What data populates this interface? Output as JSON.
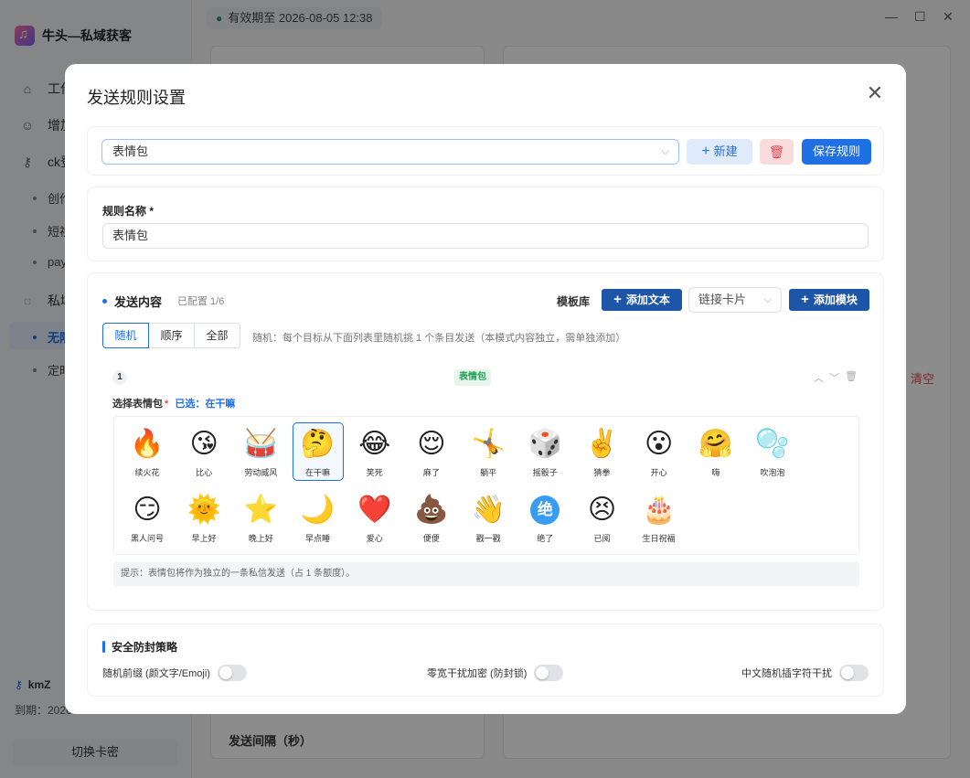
{
  "app": {
    "brand": "牛头—私域获客",
    "expiry_badge": "有效期至 2026-08-05 12:38",
    "window_controls": [
      "minimize-icon",
      "maximize-icon",
      "close-icon"
    ],
    "nav": [
      {
        "label": "工作",
        "icon": "home-icon"
      },
      {
        "label": "增加",
        "icon": "user-icon"
      },
      {
        "label": "ck登",
        "icon": "key-icon"
      }
    ],
    "nav_sub": [
      "创作",
      "短视",
      "pay"
    ],
    "nav2": {
      "label": "私域",
      "icon": "chat-icon"
    },
    "nav2_sub": [
      {
        "label": "无限",
        "active": true
      },
      {
        "label": "定时",
        "active": false
      }
    ],
    "user": {
      "name": "kmZ",
      "expiry": "到期：2026-08-05 12:38"
    },
    "switch_label": "切换卡密",
    "clear_label": "清空",
    "interval_label": "发送间隔（秒）"
  },
  "modal": {
    "title": "发送规则设置",
    "rule_select": "表情包",
    "new_label": "新建",
    "save_label": "保存规则",
    "name_label": "规则名称 *",
    "name_value": "表情包",
    "content": {
      "title": "发送内容",
      "count": "已配置 1/6",
      "template_label": "模板库",
      "add_text_label": "添加文本",
      "link_select": "链接卡片",
      "add_module_label": "添加模块",
      "modes": [
        {
          "label": "随机",
          "active": true
        },
        {
          "label": "顺序",
          "active": false
        },
        {
          "label": "全部",
          "active": false
        }
      ],
      "mode_hint": "随机：每个目标从下面列表里随机挑 1 个条目发送（本模式内容独立，需单独添加）",
      "item": {
        "index": "1",
        "tag": "表情包",
        "pick_label": "选择表情包",
        "pick_required": "*",
        "selected_label": "已选：在干嘛",
        "emojis": [
          {
            "glyph": "🔥",
            "name": "续火花"
          },
          {
            "glyph": "😘",
            "name": "比心"
          },
          {
            "glyph": "🥁",
            "name": "劳动威风"
          },
          {
            "glyph": "🤔",
            "name": "在干嘛",
            "selected": true
          },
          {
            "glyph": "😂",
            "name": "笑死"
          },
          {
            "glyph": "😌",
            "name": "麻了"
          },
          {
            "glyph": "🤸",
            "name": "躺平"
          },
          {
            "glyph": "🎲",
            "name": "摇骰子"
          },
          {
            "glyph": "✌️",
            "name": "猜拳"
          },
          {
            "glyph": "😮",
            "name": "开心"
          },
          {
            "glyph": "🤗",
            "name": "嗨"
          },
          {
            "glyph": "🫧",
            "name": "吹泡泡"
          },
          {
            "glyph": "😏",
            "name": "黑人问号"
          },
          {
            "glyph": "🌞",
            "name": "早上好"
          },
          {
            "glyph": "⭐",
            "name": "晚上好"
          },
          {
            "glyph": "🌙",
            "name": "早点睡"
          },
          {
            "glyph": "❤️",
            "name": "爱心"
          },
          {
            "glyph": "💩",
            "name": "便便"
          },
          {
            "glyph": "👋",
            "name": "戳一戳"
          },
          {
            "glyph": "绝",
            "name": "绝了"
          },
          {
            "glyph": "😣",
            "name": "已阅"
          },
          {
            "glyph": "🎂",
            "name": "生日祝福"
          }
        ],
        "tip": "提示：表情包将作为独立的一条私信发送（占 1 条额度）。"
      }
    },
    "security": {
      "title": "安全防封策略",
      "toggles": [
        {
          "label": "随机前缀 (颜文字/Emoji)",
          "on": false
        },
        {
          "label": "零宽干扰加密 (防封锁)",
          "on": false
        },
        {
          "label": "中文随机插字符干扰",
          "on": false
        }
      ]
    }
  }
}
